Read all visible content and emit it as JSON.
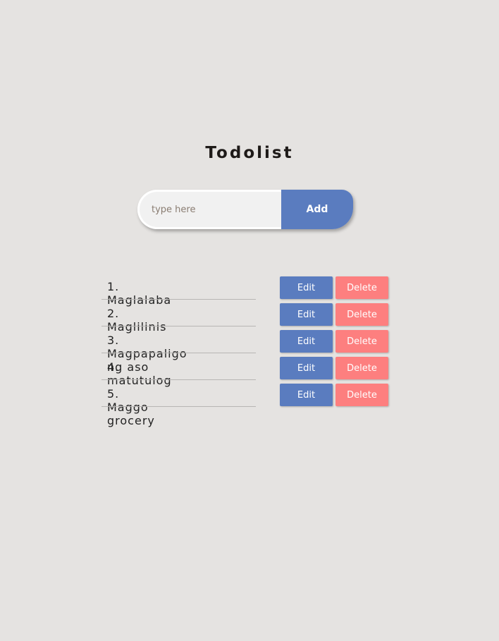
{
  "title": "Todolist",
  "form": {
    "placeholder": "type here",
    "add_label": "Add"
  },
  "items": [
    {
      "text": "1. Maglalaba"
    },
    {
      "text": "2. Maglilinis"
    },
    {
      "text": "3. Magpapaligo ng aso"
    },
    {
      "text": "4. matutulog"
    },
    {
      "text": "5. Maggo grocery"
    }
  ],
  "edit_label": "Edit",
  "delete_label": "Delete"
}
